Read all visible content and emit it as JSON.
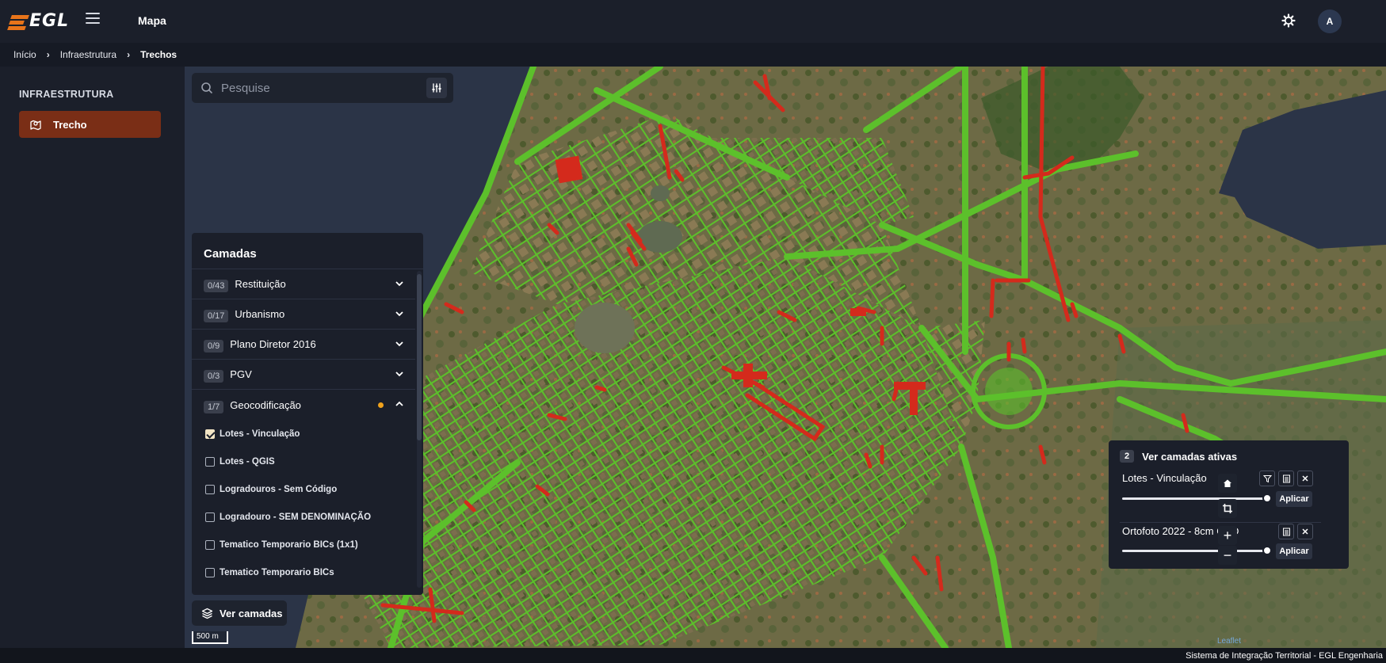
{
  "app": {
    "logo_text": "EGL",
    "page_title": "Mapa",
    "user_initial": "A"
  },
  "breadcrumb": [
    "Início",
    "Infraestrutura",
    "Trechos"
  ],
  "sidebar": {
    "heading": "INFRAESTRUTURA",
    "items": [
      {
        "label": "Trecho",
        "icon": "map-pin-icon",
        "active": true
      }
    ]
  },
  "search": {
    "placeholder": "Pesquise"
  },
  "layers": {
    "title": "Camadas",
    "groups": [
      {
        "count": "0/43",
        "name": "Restituição"
      },
      {
        "count": "0/17",
        "name": "Urbanismo"
      },
      {
        "count": "0/9",
        "name": "Plano Diretor 2016"
      },
      {
        "count": "0/3",
        "name": "PGV"
      },
      {
        "count": "1/7",
        "name": "Geocodificação"
      }
    ],
    "sublayers": [
      {
        "name": "Lotes - Vinculação",
        "checked": true
      },
      {
        "name": "Lotes - QGIS",
        "checked": false
      },
      {
        "name": "Logradouros - Sem Código",
        "checked": false
      },
      {
        "name": "Logradouro - SEM DENOMINAÇÃO",
        "checked": false
      },
      {
        "name": "Tematico Temporario BICs (1x1)",
        "checked": false
      },
      {
        "name": "Tematico Temporario BICs",
        "checked": false
      }
    ]
  },
  "ver_camadas": "Ver camadas",
  "scale_label": "500 m",
  "active_layers": {
    "count": "2",
    "title": "Ver camadas ativas",
    "items": [
      {
        "name": "Lotes - Vinculação",
        "apply_label": "Aplicar",
        "opacity": 1.0
      },
      {
        "name": "Ortofoto 2022 - 8cm GSD",
        "apply_label": "Aplicar",
        "opacity": 1.0
      }
    ]
  },
  "map_controls": {
    "zoom_in": "+",
    "zoom_out": "−"
  },
  "attribution": "Leaflet",
  "footer": "Sistema de Integração Territorial - EGL Engenharia",
  "colors": {
    "accent": "#7a2e16",
    "brand_orange": "#e8741a",
    "lots_green": "#5cc02b",
    "unlinked_red": "#d42a1c",
    "background": "#1b1f2a"
  }
}
